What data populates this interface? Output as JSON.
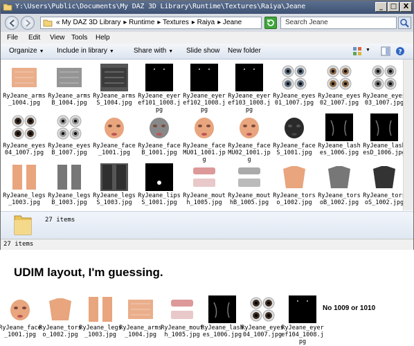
{
  "window": {
    "title": "Y:\\Users\\Public\\Documents\\My DAZ 3D Library\\Runtime\\Textures\\Raiya\\Jeane",
    "buttons": {
      "minimize": "_",
      "maximize": "□",
      "close": "X"
    }
  },
  "address": {
    "crumbs": [
      "« My DAZ 3D Library",
      "▸ Runtime",
      "▸ Textures",
      "▸ Raiya",
      "▸ Jeane"
    ],
    "search_placeholder": "Search Jeane"
  },
  "menu": {
    "file": "File",
    "edit": "Edit",
    "view": "View",
    "tools": "Tools",
    "help": "Help"
  },
  "commands": {
    "organize": "Organize",
    "include_in_library": "Include in library",
    "share_with": "Share with",
    "slide_show": "Slide show",
    "new_folder": "New folder"
  },
  "files": [
    "RyJeane_arms_1004.jpg",
    "RyJeane_armsB_1004.jpg",
    "RyJeane_armsS_1004.jpg",
    "RyJeane_eyeref101_1008.jpg",
    "RyJeane_eyeref102_1008.jpg",
    "RyJeane_eyeref103_1008.jpg",
    "RyJeane_eyes01_1007.jpg",
    "RyJeane_eyes02_1007.jpg",
    "RyJeane_eyes03_1007.jpg",
    "RyJeane_eyes04_1007.jpg",
    "RyJeane_eyesB_1007.jpg",
    "RyJeane_face_1001.jpg",
    "RyJeane_faceB_1001.jpg",
    "RyJeane_faceMU01_1001.jpg",
    "RyJeane_faceMU02_1001.jpg",
    "RyJeane_faceS_1001.jpg",
    "RyJeane_lashes_1006.jpg",
    "RyJeane_lashesD_1006.jpg",
    "RyJeane_legs_1003.jpg",
    "RyJeane_legsB_1003.jpg",
    "RyJeane_legsS_1003.jpg",
    "RyJeane_lipsS_1001.jpg",
    "RyJeane_mouth_1005.jpg",
    "RyJeane_mouthB_1005.jpg",
    "RyJeane_torso_1002.jpg",
    "RyJeane_torsoB_1002.jpg",
    "RyJeane_torsoS_1002.jpg"
  ],
  "details": {
    "count": "27 items"
  },
  "status": {
    "count": "27 items"
  },
  "caption": "UDIM layout, I'm guessing.",
  "udim_files": [
    "RyJeane_face_1001.jpg",
    "RyJeane_torso_1002.jpg",
    "RyJeane_legs_1003.jpg",
    "RyJeane_arms_1004.jpg",
    "RyJeane_mouth_1005.jpg",
    "RyJeane_lashes_1006.jpg",
    "RyJeane_eyes04_1007.jpg",
    "RyJeane_eyeref104_1008.jpg"
  ],
  "note": "No 1009 or 1010"
}
